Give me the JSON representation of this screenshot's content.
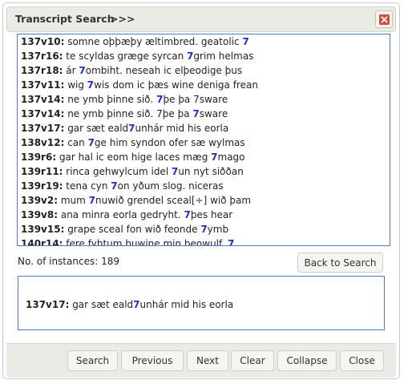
{
  "dialog": {
    "title": "Transcript Search",
    "expander": ">>>",
    "close_icon": "close-icon",
    "close_color": "#d64a3a"
  },
  "results": [
    {
      "ref": "137v10:",
      "pre": " somne oþþæþy æltimbred. geatolic ",
      "hit": "7",
      "post": ""
    },
    {
      "ref": "137r16:",
      "pre": " te scyldas græge syrcan ",
      "hit": "7",
      "post": "grim helmas"
    },
    {
      "ref": "137r18:",
      "pre": " ár ",
      "hit": "7",
      "post": "ombiht. neseah ic elþeodige þus"
    },
    {
      "ref": "137v11:",
      "pre": " wig ",
      "hit": "7",
      "post": "wis dom ic þæs wine deniga frean"
    },
    {
      "ref": "137v14:",
      "pre": " ne ymb þinne sið. ",
      "hit": "7",
      "post": "þe þa 7sware"
    },
    {
      "ref": "137v14:",
      "pre": " ne ymb þinne sið. 7þe þa ",
      "hit": "7",
      "post": "sware"
    },
    {
      "ref": "137v17:",
      "pre": " gar sæt eald",
      "hit": "7",
      "post": "unhár mid his eorla"
    },
    {
      "ref": "138v12:",
      "pre": " can ",
      "hit": "7",
      "post": "ge him syndon ofer sæ wylmas"
    },
    {
      "ref": "139r6:",
      "pre": " gar hal ic eom hige laces mæg ",
      "hit": "7",
      "post": "mago"
    },
    {
      "ref": "139r11:",
      "pre": " rinca gehwylcum idel ",
      "hit": "7",
      "post": "un nyt siððan"
    },
    {
      "ref": "139r19:",
      "pre": " tena cyn ",
      "hit": "7",
      "post": "on yðum slog. niceras"
    },
    {
      "ref": "139v2:",
      "pre": " mum ",
      "hit": "7",
      "post": "nuwið grendel sceal[÷] wið þam"
    },
    {
      "ref": "139v8:",
      "pre": " ana minra eorla gedryht. ",
      "hit": "7",
      "post": "þes hear"
    },
    {
      "ref": "139v15:",
      "pre": " grape sceal fon wið feonde ",
      "hit": "7",
      "post": "ymb"
    },
    {
      "ref": "140r14:",
      "pre": " fere fyhtum þuwine min beowulf. ",
      "hit": "7",
      "post": ""
    }
  ],
  "instances_label": "No. of instances: 189",
  "back_button": "Back to Search",
  "detail": {
    "ref": "137v17:",
    "pre": " gar sæt eald",
    "hit": "7",
    "post": "unhár mid his eorla"
  },
  "buttons": {
    "search": "Search",
    "previous": "Previous",
    "next": "Next",
    "clear": "Clear",
    "collapse": "Collapse",
    "close": "Close"
  },
  "colors": {
    "hit": "#1b32c7",
    "border": "#4a7bc9"
  }
}
